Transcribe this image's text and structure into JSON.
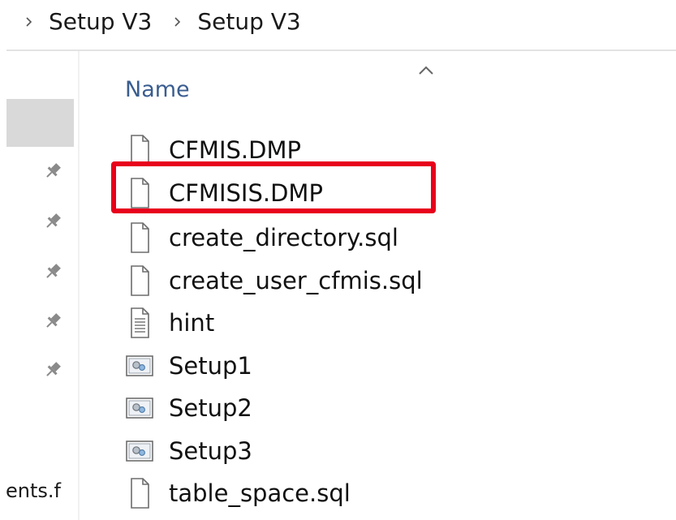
{
  "breadcrumb": {
    "items": [
      {
        "label": "Setup V3"
      },
      {
        "label": "Setup V3"
      }
    ]
  },
  "nav": {
    "truncated_label": "ents.f",
    "pinned_count": 5
  },
  "columns": {
    "name": "Name",
    "sort": "ascending"
  },
  "files": [
    {
      "name": "CFMIS.DMP",
      "icon": "file-icon"
    },
    {
      "name": "CFMISIS.DMP",
      "icon": "file-icon",
      "highlighted": true
    },
    {
      "name": "create_directory.sql",
      "icon": "file-icon"
    },
    {
      "name": "create_user_cfmis.sql",
      "icon": "file-icon"
    },
    {
      "name": "hint",
      "icon": "text-file-icon"
    },
    {
      "name": "Setup1",
      "icon": "config-file-icon"
    },
    {
      "name": "Setup2",
      "icon": "config-file-icon"
    },
    {
      "name": "Setup3",
      "icon": "config-file-icon"
    },
    {
      "name": "table_space.sql",
      "icon": "file-icon"
    }
  ],
  "colors": {
    "highlight": "#e8001c",
    "header_text": "#3a5d8f",
    "nav_selected": "#d9d9d9"
  }
}
